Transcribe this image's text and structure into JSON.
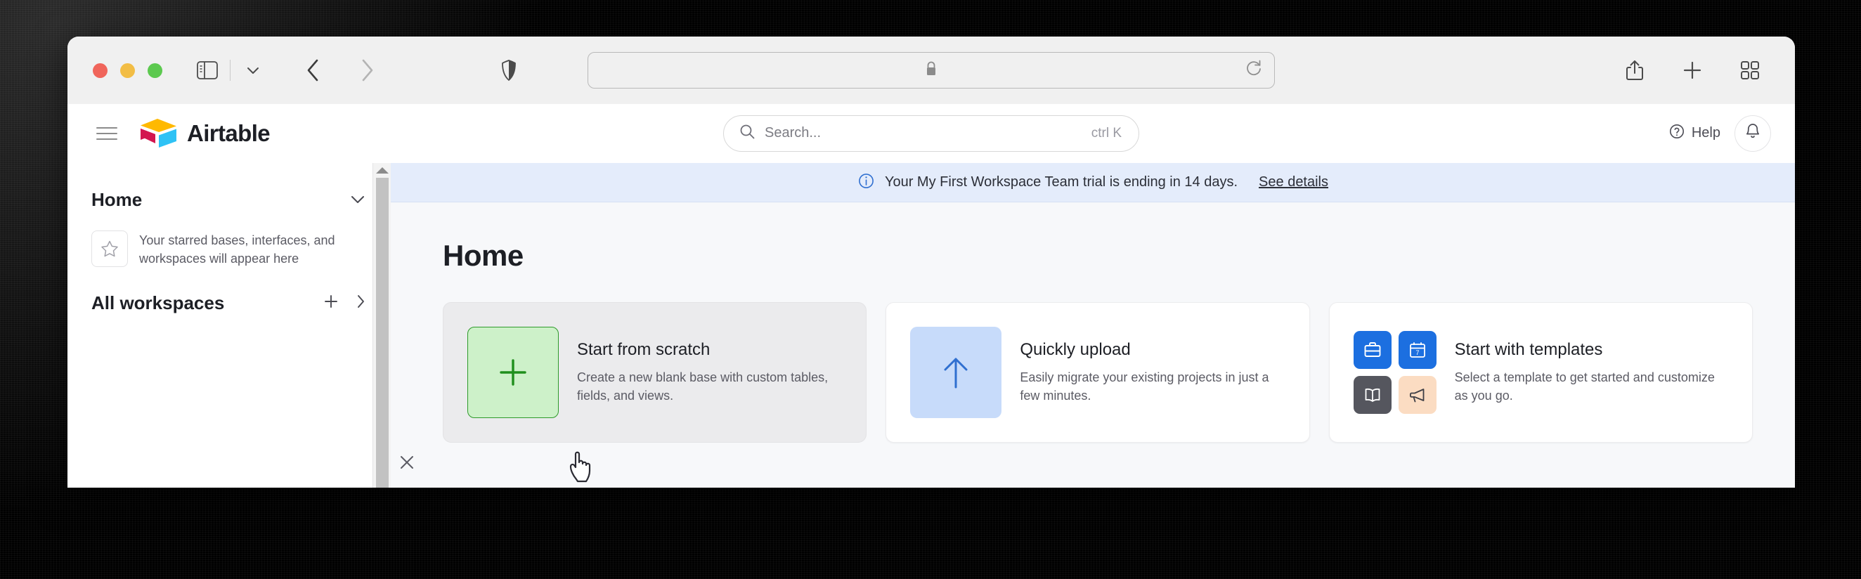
{
  "browser": {
    "traffic_lights": [
      "close",
      "minimize",
      "maximize"
    ],
    "sidebar_toggle_icon": "sidebar-icon",
    "sidebar_dropdown_icon": "chevron-down-icon",
    "back_icon": "chevron-left-icon",
    "forward_icon": "chevron-right-icon",
    "shield_icon": "shield-icon",
    "url_value": "",
    "url_placeholder": "",
    "lock_icon": "lock-icon",
    "reload_icon": "reload-icon",
    "share_icon": "share-icon",
    "new_tab_icon": "plus-icon",
    "tab_overview_icon": "tab-overview-icon"
  },
  "app_header": {
    "menu_icon": "hamburger-icon",
    "brand": "Airtable",
    "brand_logo_colors": {
      "top": "#ffb900",
      "left": "#d3164f",
      "right": "#2ec2f5"
    },
    "search": {
      "icon": "search-icon",
      "placeholder": "Search...",
      "value": "",
      "shortcut": "ctrl K"
    },
    "help_label": "Help",
    "help_icon": "question-circle-icon",
    "notifications_icon": "bell-icon"
  },
  "sidebar": {
    "home_label": "Home",
    "home_collapse_icon": "chevron-down-icon",
    "starred_icon": "star-icon",
    "starred_empty_text": "Your starred bases, interfaces, and workspaces will appear here",
    "all_workspaces_label": "All workspaces",
    "add_workspace_icon": "plus-icon",
    "expand_workspaces_icon": "chevron-right-icon",
    "close_icon": "close-icon",
    "scrollbar": {
      "up_arrow_icon": "caret-up-icon"
    }
  },
  "banner": {
    "info_icon": "info-circle-icon",
    "message": "Your My First Workspace Team trial is ending in 14 days.",
    "link_label": "See details",
    "background_color": "#e4ecfb"
  },
  "main": {
    "page_title": "Home",
    "cards": [
      {
        "title": "Start from scratch",
        "description": "Create a new blank base with custom tables, fields, and views.",
        "icon": "plus-icon",
        "icon_style": "green-tile",
        "hovered": true
      },
      {
        "title": "Quickly upload",
        "description": "Easily migrate your existing projects in just a few minutes.",
        "icon": "arrow-up-icon",
        "icon_style": "blue-tile",
        "hovered": false
      },
      {
        "title": "Start with templates",
        "description": "Select a template to get started and customize as you go.",
        "icon": "template-grid-icon",
        "icon_style": "grid-tiles",
        "template_icons": [
          "briefcase-icon",
          "calendar-icon",
          "book-icon",
          "megaphone-icon"
        ],
        "calendar_day": "7",
        "hovered": false
      }
    ]
  },
  "cursor": {
    "type": "pointer-hand"
  }
}
